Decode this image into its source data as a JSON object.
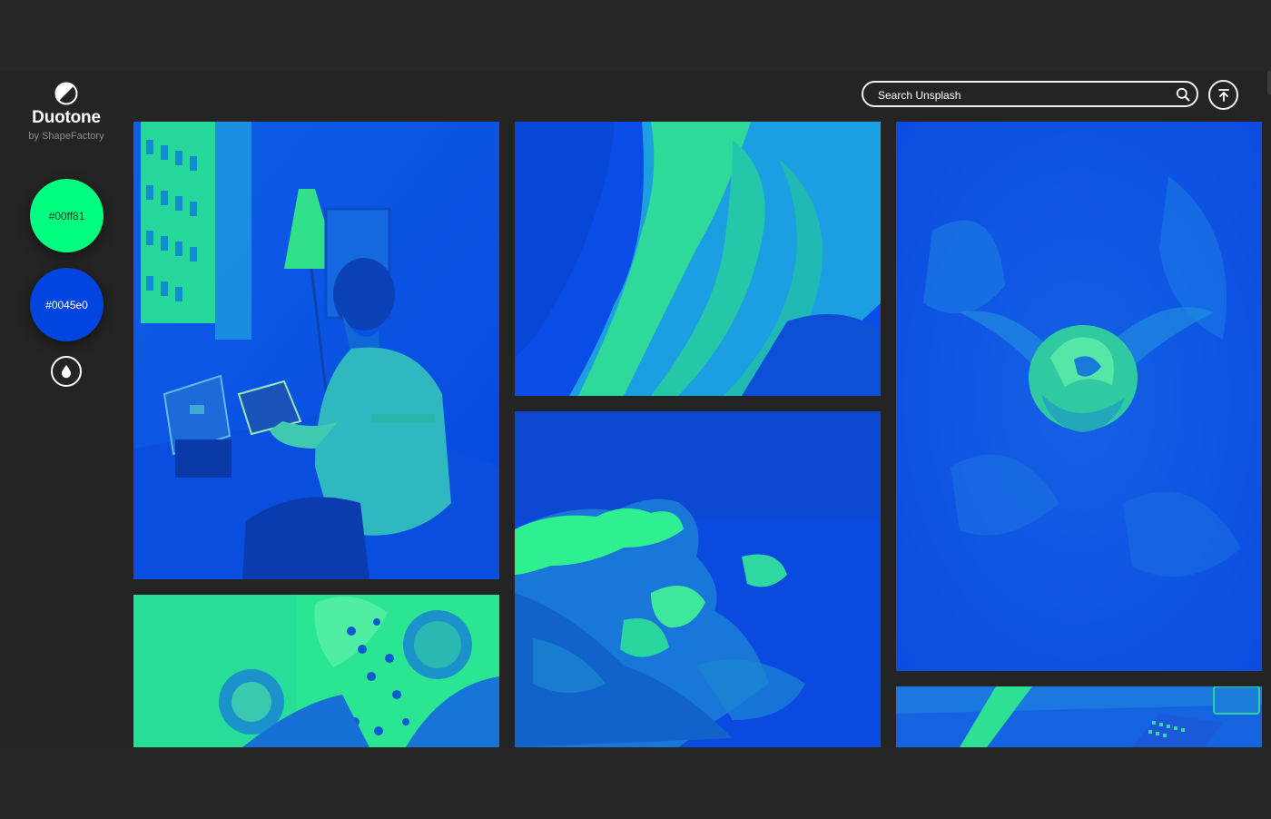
{
  "app": {
    "title": "Duotone",
    "subtitle": "by ShapeFactory"
  },
  "colors": {
    "light": "#00ff81",
    "dark": "#0045e0",
    "background": "#262626"
  },
  "swatches": [
    {
      "label": "#00ff81",
      "color": "#00ff81"
    },
    {
      "label": "#0045e0",
      "color": "#0045e0"
    }
  ],
  "search": {
    "placeholder": "Search Unsplash"
  },
  "icons": {
    "logo": "half-circle-logo-icon",
    "drop": "color-drop-icon",
    "search": "search-icon",
    "scroll_top": "arrow-to-top-icon"
  },
  "photos": [
    {
      "subject": "man-with-laptop"
    },
    {
      "subject": "canyon"
    },
    {
      "subject": "flower-bud"
    },
    {
      "subject": "waves-on-rocks"
    },
    {
      "subject": "flowers-bouquet"
    },
    {
      "subject": "desk"
    }
  ]
}
